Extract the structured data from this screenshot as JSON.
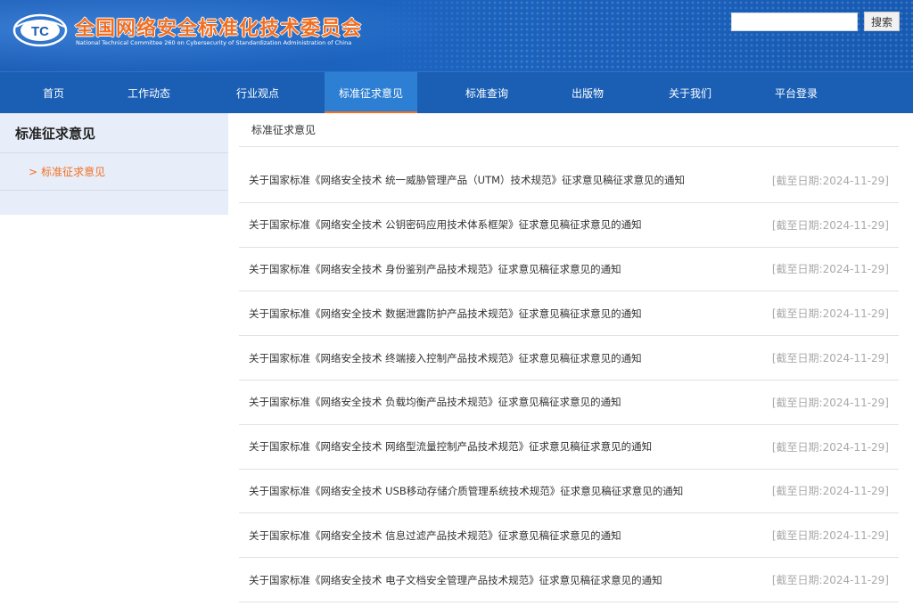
{
  "header": {
    "logo_text": "TC",
    "title": "全国网络安全标准化技术委员会",
    "subtitle": "National Technical Committee 260 on Cybersecurity of Standardization Administration of China",
    "search_placeholder": "",
    "search_label": "搜索"
  },
  "nav": {
    "items": [
      {
        "label": "首页"
      },
      {
        "label": "工作动态"
      },
      {
        "label": "行业观点"
      },
      {
        "label": "标准征求意见"
      },
      {
        "label": "标准查询"
      },
      {
        "label": "出版物"
      },
      {
        "label": "关于我们"
      },
      {
        "label": "平台登录"
      }
    ],
    "active_index": 3
  },
  "sidebar": {
    "title": "标准征求意见",
    "link_arrow": ">",
    "link_label": "标准征求意见"
  },
  "main": {
    "breadcrumb": "标准征求意见",
    "rows": [
      {
        "title": "关于国家标准《网络安全技术 统一威胁管理产品（UTM）技术规范》征求意见稿征求意见的通知",
        "date": "[截至日期:2024-11-29]"
      },
      {
        "title": "关于国家标准《网络安全技术 公钥密码应用技术体系框架》征求意见稿征求意见的通知",
        "date": "[截至日期:2024-11-29]"
      },
      {
        "title": "关于国家标准《网络安全技术 身份鉴别产品技术规范》征求意见稿征求意见的通知",
        "date": "[截至日期:2024-11-29]"
      },
      {
        "title": "关于国家标准《网络安全技术 数据泄露防护产品技术规范》征求意见稿征求意见的通知",
        "date": "[截至日期:2024-11-29]"
      },
      {
        "title": "关于国家标准《网络安全技术 终端接入控制产品技术规范》征求意见稿征求意见的通知",
        "date": "[截至日期:2024-11-29]"
      },
      {
        "title": "关于国家标准《网络安全技术 负载均衡产品技术规范》征求意见稿征求意见的通知",
        "date": "[截至日期:2024-11-29]"
      },
      {
        "title": "关于国家标准《网络安全技术 网络型流量控制产品技术规范》征求意见稿征求意见的通知",
        "date": "[截至日期:2024-11-29]"
      },
      {
        "title": "关于国家标准《网络安全技术 USB移动存储介质管理系统技术规范》征求意见稿征求意见的通知",
        "date": "[截至日期:2024-11-29]"
      },
      {
        "title": "关于国家标准《网络安全技术 信息过滤产品技术规范》征求意见稿征求意见的通知",
        "date": "[截至日期:2024-11-29]"
      },
      {
        "title": "关于国家标准《网络安全技术 电子文档安全管理产品技术规范》征求意见稿征求意见的通知",
        "date": "[截至日期:2024-11-29]"
      }
    ]
  },
  "colors": {
    "brand_blue": "#1a5fb4",
    "accent_orange": "#f26f21",
    "active_nav": "#2d7fd3"
  }
}
